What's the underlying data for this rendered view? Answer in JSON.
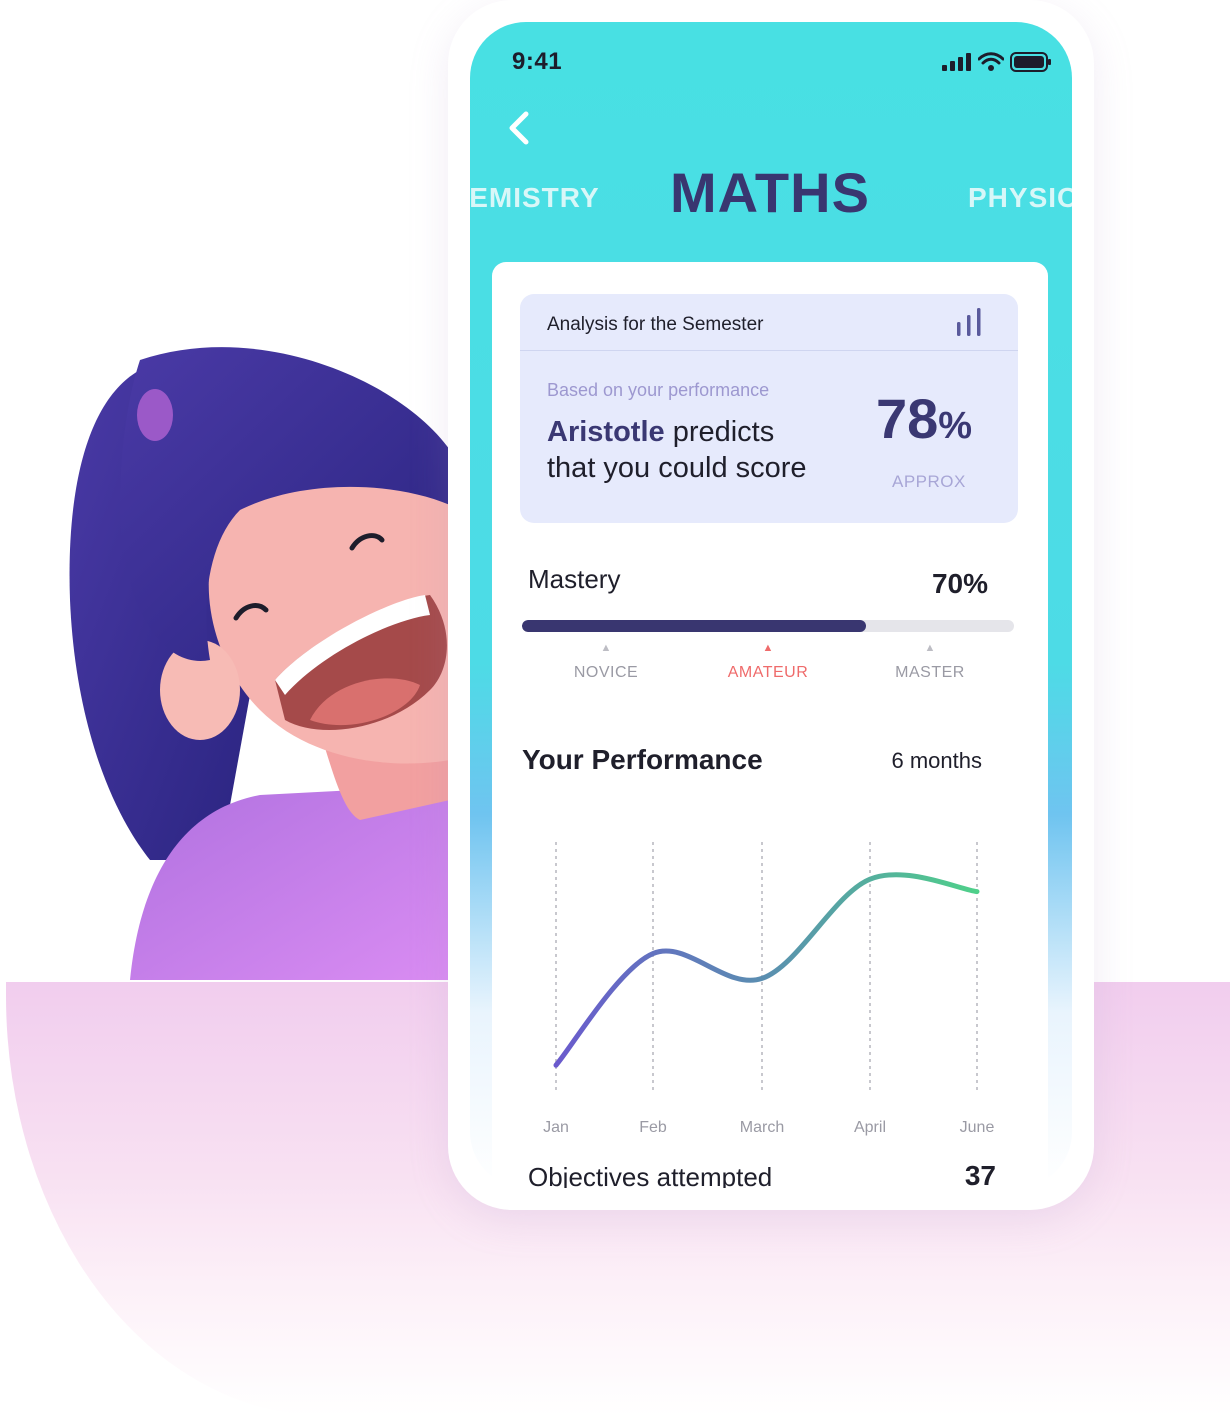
{
  "status_bar": {
    "time": "9:41",
    "signal_icon": "signal-bars-icon",
    "wifi_icon": "wifi-icon",
    "battery_icon": "battery-icon"
  },
  "nav": {
    "back_icon": "chevron-left-icon"
  },
  "subject_tabs": {
    "left": "HEMISTRY",
    "active": "MATHS",
    "right": "PHYSIC"
  },
  "analysis": {
    "title": "Analysis for the Semester",
    "chart_icon": "bar-chart-icon",
    "subtitle": "Based on your performance",
    "brand": "Aristotle",
    "prediction_text_1": " predicts",
    "prediction_text_2": "that you could score",
    "score": "78",
    "score_unit": "%",
    "score_note": "APPROX"
  },
  "mastery": {
    "label": "Mastery",
    "value_text": "70%",
    "progress": 0.7,
    "levels": [
      {
        "label": "NOVICE",
        "active": false
      },
      {
        "label": "AMATEUR",
        "active": true
      },
      {
        "label": "MASTER",
        "active": false
      }
    ]
  },
  "performance": {
    "title": "Your Performance",
    "range": "6 months"
  },
  "chart_data": {
    "type": "line",
    "categories": [
      "Jan",
      "Feb",
      "March",
      "April",
      "June"
    ],
    "series": [
      {
        "values": [
          10,
          55,
          45,
          85,
          80
        ]
      }
    ],
    "ylim": [
      0,
      100
    ],
    "grid": "vertical dashed",
    "colors": [
      "#6a5acd",
      "#4fd08a"
    ]
  },
  "objectives": {
    "label": "Objectives attempted",
    "value": "37"
  },
  "colors": {
    "teal": "#48e0e3",
    "navy": "#393670",
    "accent_red": "#ef6b6b",
    "lavender": "#e6eafc"
  }
}
